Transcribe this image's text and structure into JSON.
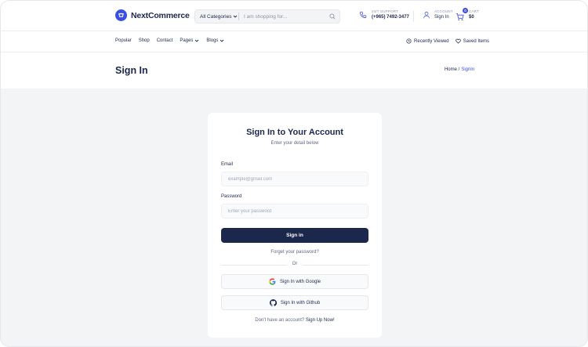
{
  "brand": {
    "name": "NextCommerce"
  },
  "search": {
    "category": "All Categories",
    "placeholder": "I am shopping for..."
  },
  "support": {
    "label": "24/7 SUPPORT",
    "phone": "(+965) 7492-3477"
  },
  "account": {
    "label": "ACCOUNT",
    "action": "Sign In"
  },
  "cart": {
    "label": "CART",
    "total": "$0",
    "count": "0"
  },
  "nav": {
    "items": [
      {
        "label": "Popular"
      },
      {
        "label": "Shop"
      },
      {
        "label": "Contact"
      },
      {
        "label": "Pages"
      },
      {
        "label": "Blogs"
      }
    ],
    "recently_viewed": "Recently Viewed",
    "saved_items": "Saved Items"
  },
  "page": {
    "title": "Sign In",
    "breadcrumb_home": "Home /",
    "breadcrumb_current": "Signin"
  },
  "form": {
    "title": "Sign In to Your Account",
    "subtitle": "Enter your detail below",
    "email_label": "Email",
    "email_placeholder": "example@gmail.com",
    "password_label": "Password",
    "password_placeholder": "Enter your password",
    "submit_label": "Sign in",
    "forgot_label": "Forget your password?",
    "or_label": "Or",
    "google_label": "Sign In with Google",
    "github_label": "Sign In with Github",
    "signup_prompt": "Don't have an account?",
    "signup_link": "Sign Up Now!"
  },
  "colors": {
    "primary": "#3c50e0",
    "dark": "#1c274c",
    "background": "#f3f4f6"
  }
}
